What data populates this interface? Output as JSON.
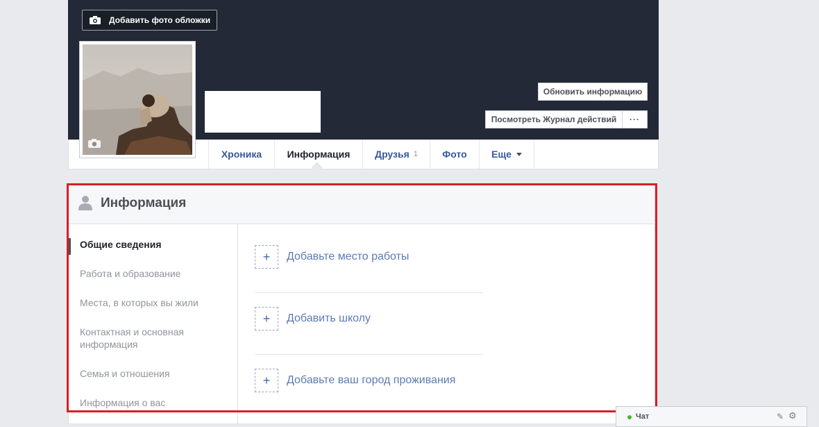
{
  "cover": {
    "add_cover_label": "Добавить фото обложки"
  },
  "actions": {
    "update_info": "Обновить информацию",
    "activity_log": "Посмотреть Журнал действий",
    "more": "···"
  },
  "tabs": [
    {
      "label": "Хроника"
    },
    {
      "label": "Информация",
      "active": true
    },
    {
      "label": "Друзья",
      "count": "1"
    },
    {
      "label": "Фото"
    },
    {
      "label": "Еще"
    }
  ],
  "info": {
    "title": "Информация",
    "sidebar": [
      {
        "label": "Общие сведения",
        "active": true
      },
      {
        "label": "Работа и образование"
      },
      {
        "label": "Места, в которых вы жили"
      },
      {
        "label": "Контактная и основная информация"
      },
      {
        "label": "Семья и отношения"
      },
      {
        "label": "Информация о вас"
      }
    ],
    "add_items": [
      {
        "icon": "plus-icon",
        "label": "Добавьте место работы"
      },
      {
        "icon": "plus-icon",
        "label": "Добавить школу"
      },
      {
        "icon": "plus-icon",
        "label": "Добавьте ваш город проживания"
      }
    ]
  },
  "chat": {
    "label": "Чат",
    "status_color": "#42b72a"
  },
  "colors": {
    "cover_bg": "#232937",
    "link": "#365899",
    "highlight": "#d61f26"
  }
}
